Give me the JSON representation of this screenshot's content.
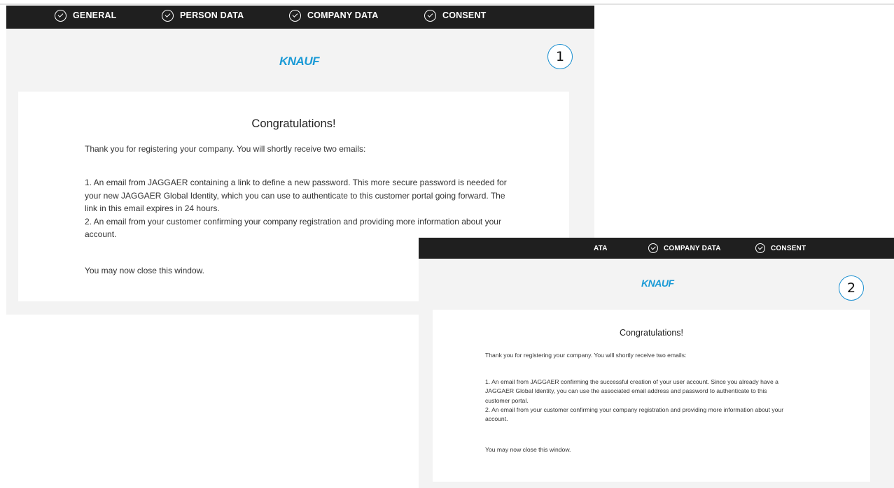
{
  "screens": [
    {
      "steps": [
        "GENERAL",
        "PERSON DATA",
        "COMPANY DATA",
        "CONSENT"
      ],
      "logo": "KNAUF",
      "badge": "1",
      "card": {
        "title": "Congratulations!",
        "intro": "Thank you for registering your company. You will shortly receive two emails:",
        "item1_lines": [
          "1. An email from JAGGAER containing a link to define a new password. This more secure password is needed for",
          "your new JAGGAER Global Identity, which you can use to authenticate to this customer portal going forward. The",
          "link in this email expires in 24 hours."
        ],
        "item2_lines": [
          "2. An email from your customer confirming your company registration and providing more information about your",
          "account."
        ],
        "closing": "You may now close this window."
      }
    },
    {
      "steps": [
        "ATA",
        "COMPANY DATA",
        "CONSENT"
      ],
      "logo": "KNAUF",
      "badge": "2",
      "card": {
        "title": "Congratulations!",
        "intro": "Thank you for registering your company. You will shortly receive two emails:",
        "item1_lines": [
          "1. An email from JAGGAER confirming the successful creation of your user account. Since you already have a",
          "JAGGAER Global Identity, you can use the associated email address and password to authenticate to this",
          "customer portal."
        ],
        "item2_lines": [
          "2. An email from your customer confirming your company registration and providing more information about your",
          "account."
        ],
        "closing": "You may now close this window."
      }
    }
  ],
  "colors": {
    "stepbar": "#1f1f1f",
    "brand": "#1a9ad6",
    "badge_border": "#1a8fd0",
    "panel": "#f3f3f3"
  }
}
